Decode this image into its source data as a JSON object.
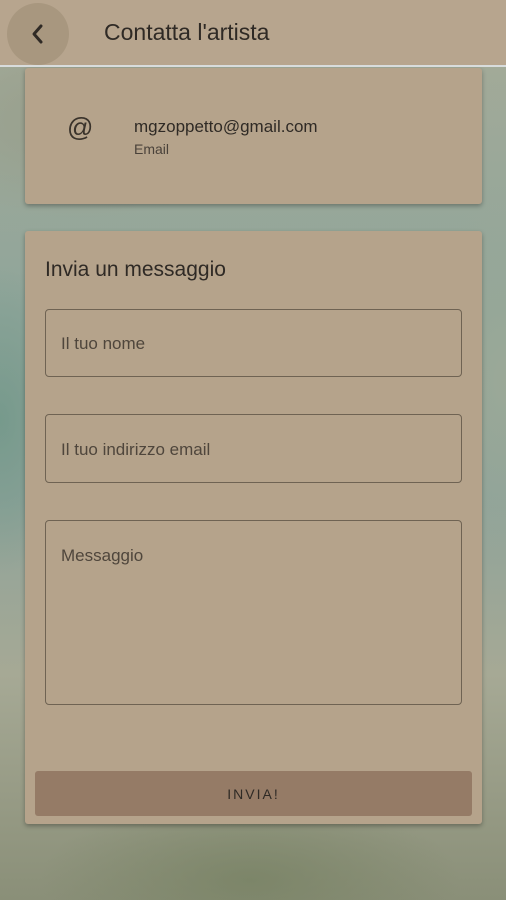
{
  "header": {
    "title": "Contatta l'artista",
    "back_icon": "chevron-left-icon"
  },
  "contact": {
    "icon": "at-icon",
    "icon_glyph": "@",
    "email": "mgzoppetto@gmail.com",
    "email_label": "Email"
  },
  "form": {
    "title": "Invia un messaggio",
    "name_placeholder": "Il tuo nome",
    "email_placeholder": "Il tuo indirizzo email",
    "message_placeholder": "Messaggio",
    "submit_label": "INVIA!"
  },
  "colors": {
    "card": "#b5a38b",
    "header": "#b7a58e",
    "button": "#957b66",
    "text": "#2f2a25"
  }
}
